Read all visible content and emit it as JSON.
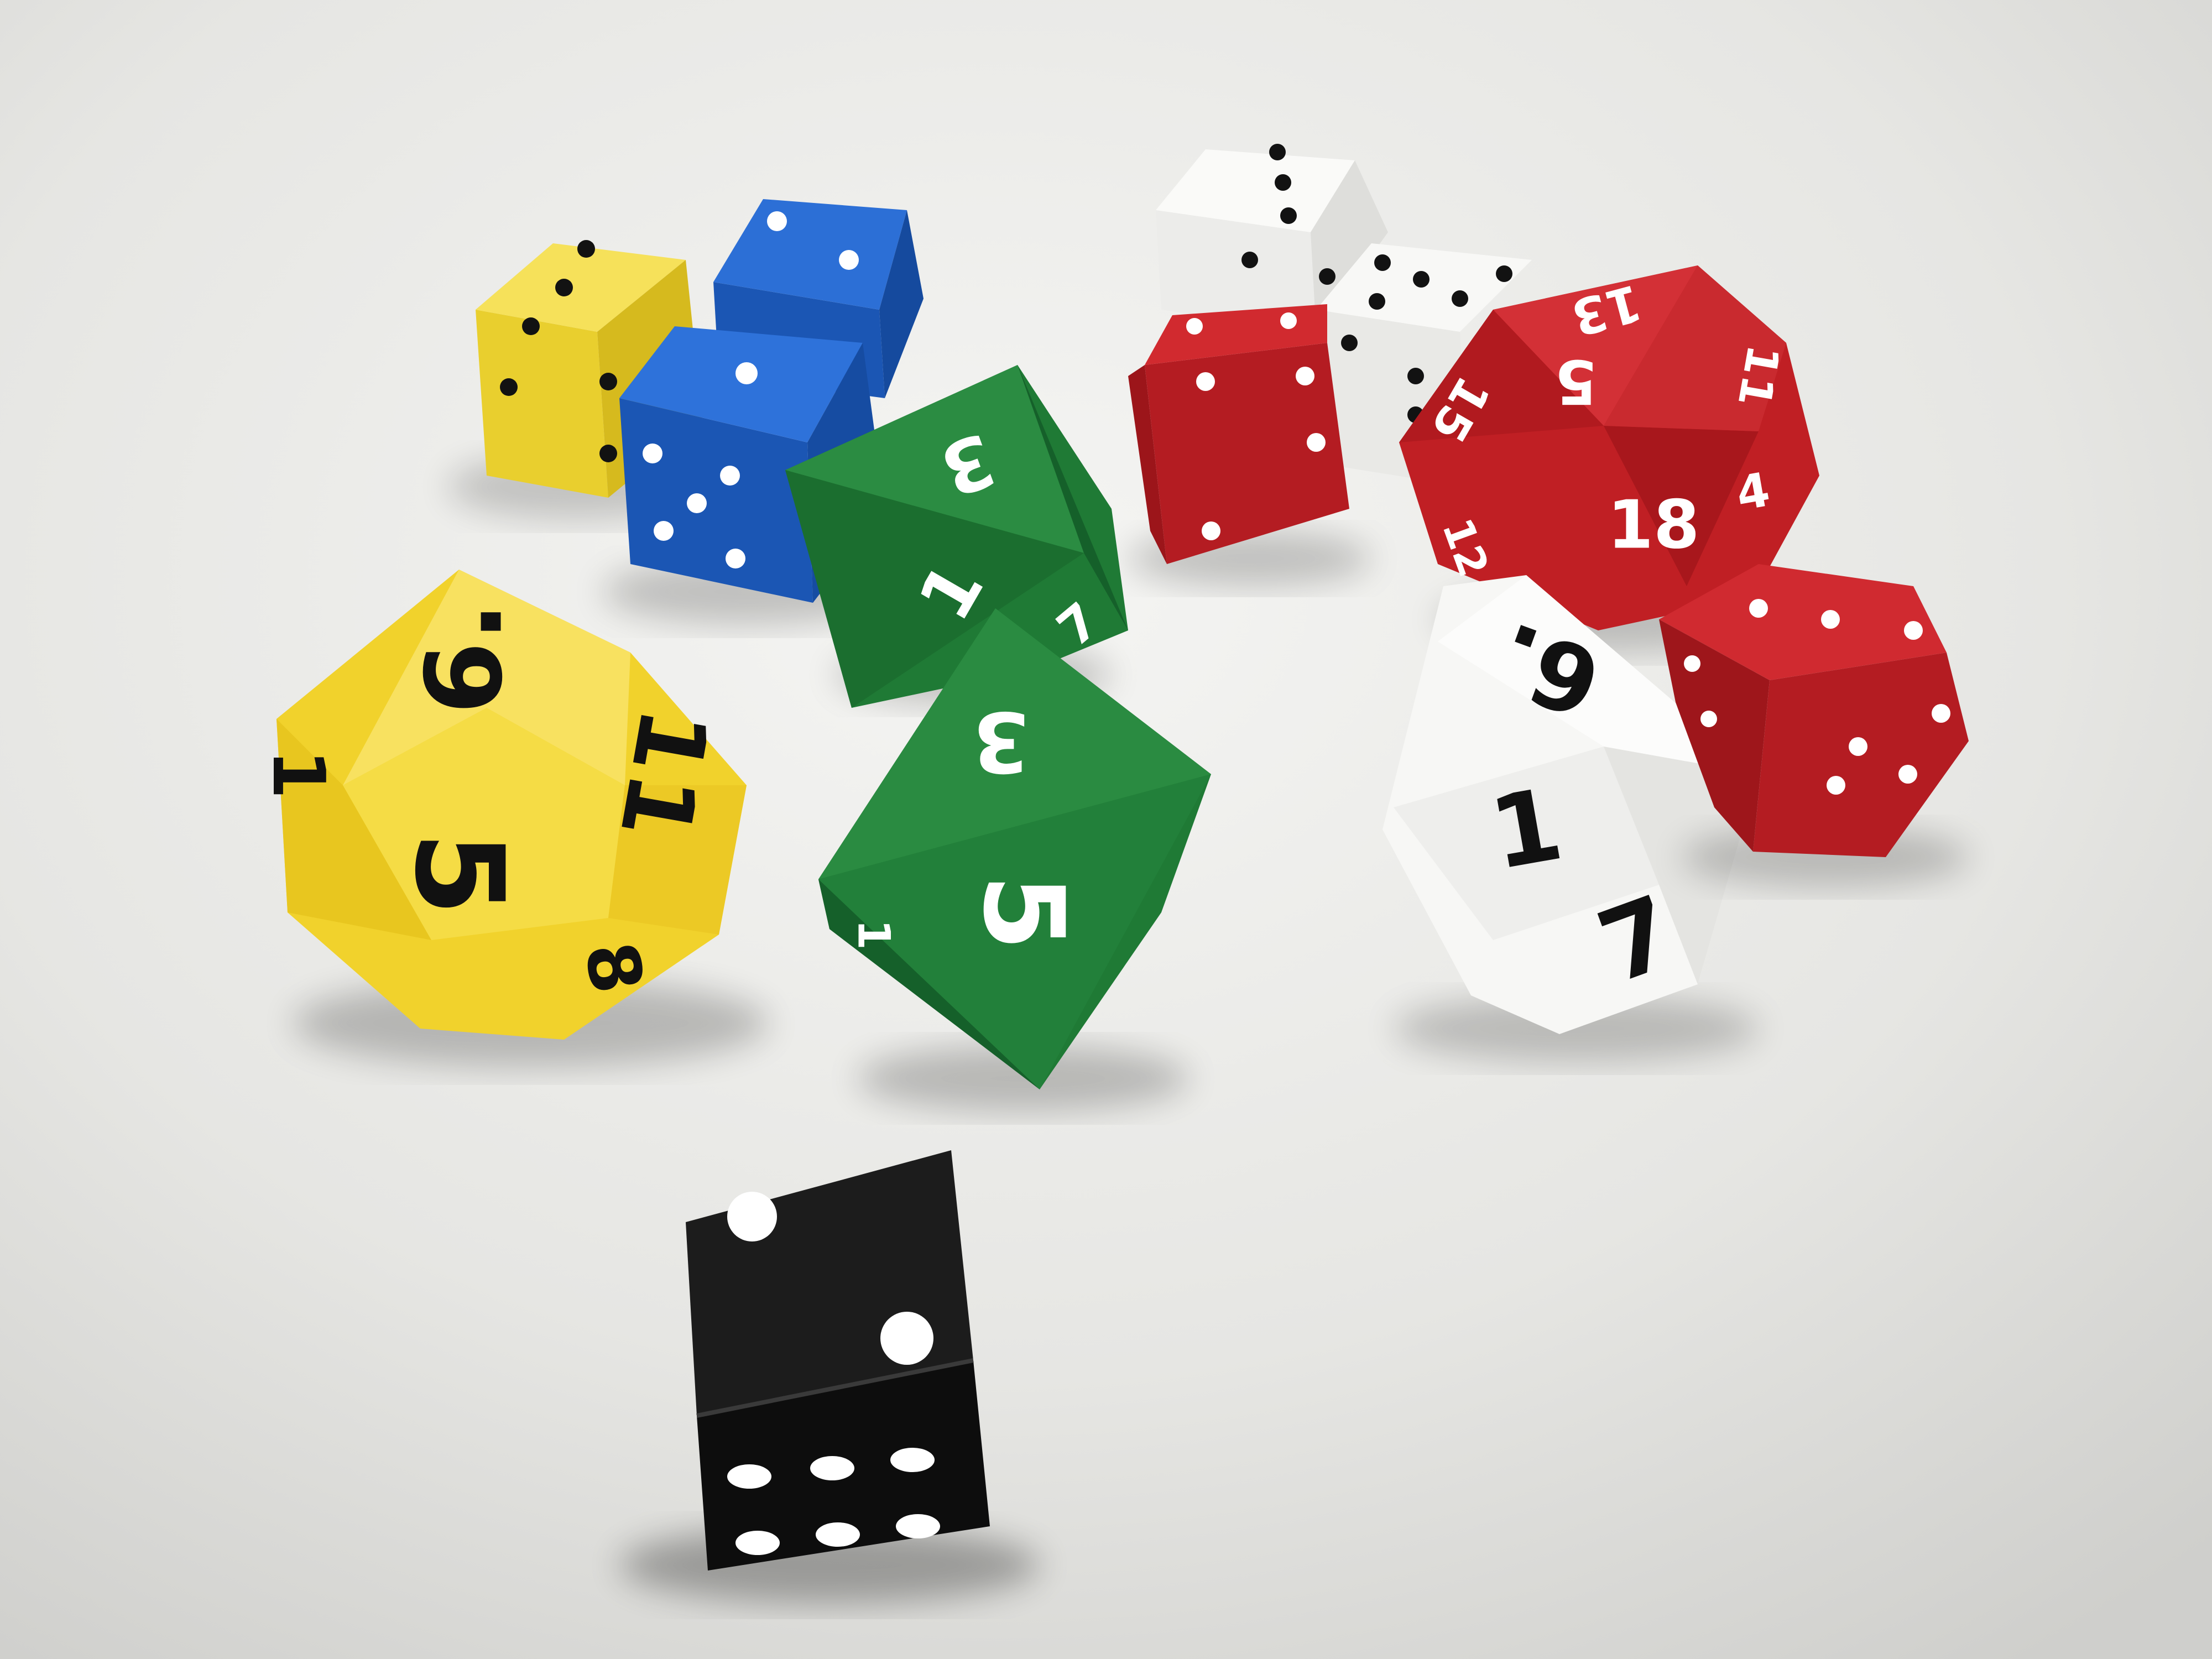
{
  "scene": {
    "subject": "polyhedral dice on a white table",
    "colors": {
      "table_light": "#f4f4f2",
      "table_dark": "#d6d6d3",
      "yellow": "#f4dc3a",
      "blue": "#1f5fc4",
      "green": "#1f7a35",
      "red": "#c01f24",
      "white_die": "#f7f7f5",
      "black_die": "#141414",
      "pip_dark": "#121212",
      "pip_light": "#ffffff"
    }
  },
  "dice": [
    {
      "name": "yellow-d6",
      "type": "d6",
      "color": "yellow",
      "top_value": 3,
      "markings": "pips"
    },
    {
      "name": "blue-d6-back",
      "type": "d6",
      "color": "blue",
      "top_value": 2,
      "markings": "pips"
    },
    {
      "name": "blue-d6-front",
      "type": "d6",
      "color": "blue",
      "top_value": 1,
      "markings": "pips"
    },
    {
      "name": "white-d6-back",
      "type": "d6",
      "color": "white",
      "top_value": 3,
      "markings": "pips"
    },
    {
      "name": "white-d6-middle",
      "type": "d6",
      "color": "white",
      "top_value": 5,
      "markings": "pips"
    },
    {
      "name": "red-d6-back",
      "type": "d6",
      "color": "red",
      "top_value": 4,
      "markings": "pips"
    },
    {
      "name": "red-d6-front",
      "type": "d6",
      "color": "red",
      "top_value": 3,
      "markings": "pips"
    },
    {
      "name": "black-d6",
      "type": "d6",
      "color": "black",
      "top_value": 2,
      "markings": "pips"
    },
    {
      "name": "green-d8-back",
      "type": "d8",
      "color": "green",
      "labels": [
        "3",
        "1",
        "7"
      ]
    },
    {
      "name": "green-d8-front",
      "type": "d8",
      "color": "green",
      "labels": [
        "3",
        "5",
        "1"
      ]
    },
    {
      "name": "yellow-d12",
      "type": "d12",
      "color": "yellow",
      "labels": [
        "6.",
        "11",
        "5",
        "1",
        "8"
      ]
    },
    {
      "name": "red-d20",
      "type": "d20",
      "color": "red",
      "labels": [
        "13",
        "5",
        "15",
        "18",
        "4",
        "11",
        "12"
      ]
    },
    {
      "name": "white-d10",
      "type": "d10",
      "color": "white",
      "labels": [
        "6.",
        "1",
        "7"
      ]
    }
  ]
}
